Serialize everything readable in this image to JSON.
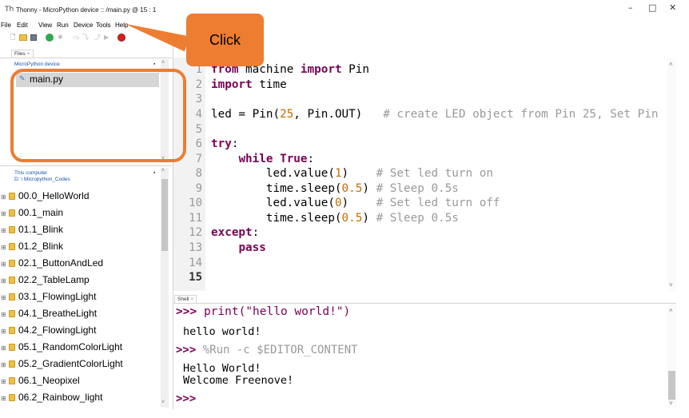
{
  "window": {
    "title": "Thonny - MicroPython device :: /main.py @ 15 : 1",
    "app_icon": "Th",
    "minimize": "–",
    "maximize": "□",
    "close": "✕"
  },
  "menu": {
    "items": [
      "File",
      "Edit",
      "View",
      "Run",
      "Device",
      "Tools",
      "Help"
    ]
  },
  "toolbar": {
    "icons": [
      "new-file-icon",
      "open-file-icon",
      "save-icon",
      "run-icon",
      "debug-icon",
      "step-over-icon",
      "step-into-icon",
      "step-out-icon",
      "resume-icon",
      "stop-icon"
    ]
  },
  "files_panel": {
    "tab_label": "Files",
    "tab_close": "×",
    "device_header": "MicroPython device",
    "device_files": [
      "main.py"
    ],
    "computer_header": "This computer",
    "computer_path": "D: \\ Micropython_Codes",
    "folders": [
      "00.0_HelloWorld",
      "00.1_main",
      "01.1_Blink",
      "01.2_Blink",
      "02.1_ButtonAndLed",
      "02.2_TableLamp",
      "03.1_FlowingLight",
      "04.1_BreatheLight",
      "04.2_FlowingLight",
      "05.1_RandomColorLight",
      "05.2_GradientColorLight",
      "06.1_Neopixel",
      "06.2_Rainbow_light"
    ]
  },
  "editor": {
    "line_numbers": [
      "1",
      "2",
      "3",
      "4",
      "5",
      "6",
      "7",
      "8",
      "9",
      "10",
      "11",
      "12",
      "13",
      "14",
      "15"
    ]
  },
  "shell": {
    "tab_label": "Shell",
    "tab_close": "×",
    "prompt": ">>>",
    "cmd1": "print(\"hello world!\")",
    "out1": "hello world!",
    "cmd2": "%Run -c $EDITOR_CONTENT",
    "out2": "Hello World!",
    "out3": "Welcome Freenove!"
  },
  "annotation": {
    "callout_text": "Click",
    "color": "#ed7d31"
  },
  "colors": {
    "keyword": "#7a0056",
    "number": "#c66a00",
    "comment": "#9a9a9a",
    "panel_header": "#1a54a8"
  }
}
